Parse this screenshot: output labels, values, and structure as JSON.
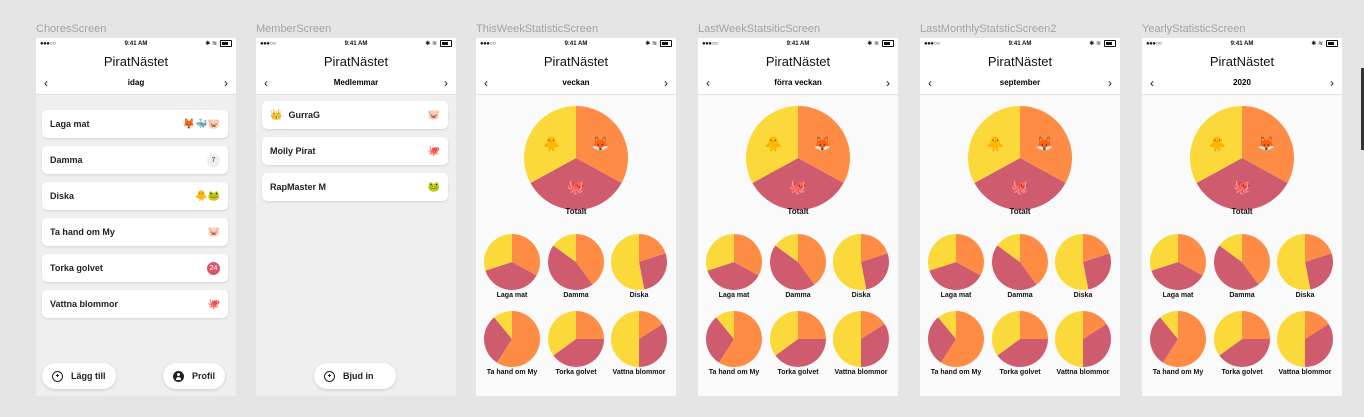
{
  "colors": {
    "orange": "#ff8c45",
    "pink": "#cf5c6e",
    "yellow": "#fcd93b"
  },
  "status": {
    "carrier": "●●●○○",
    "time": "9:41 AM",
    "icons": "✱ ≋"
  },
  "app_title": "PiratNästet",
  "frames": [
    {
      "label": "ChoresScreen",
      "nav_title": "idag"
    },
    {
      "label": "MemberScreen",
      "nav_title": "Medlemmar"
    },
    {
      "label": "ThisWeekStatisticScreen",
      "nav_title": "veckan"
    },
    {
      "label": "LastWeekStatsiticScreen",
      "nav_title": "förra veckan"
    },
    {
      "label": "LastMonthlyStatsticScreen2",
      "nav_title": "september"
    },
    {
      "label": "YearlyStatisticScreen",
      "nav_title": "2020"
    }
  ],
  "chores": [
    {
      "name": "Laga mat",
      "emojis": "🦊🐳🐷"
    },
    {
      "name": "Damma",
      "badge": "7"
    },
    {
      "name": "Diska",
      "emojis": "🐥🐸"
    },
    {
      "name": "Ta hand om My",
      "emojis": "🐷"
    },
    {
      "name": "Torka golvet",
      "badge": "24",
      "badge_red": true
    },
    {
      "name": "Vattna blommor",
      "emojis": "🐙"
    }
  ],
  "chores_buttons": {
    "add": "Lägg till",
    "profile": "Profil"
  },
  "members": [
    {
      "lead": "👑",
      "name": "GurraG",
      "emoji": "🐷"
    },
    {
      "name": "Molly Pirat",
      "emoji": "🐙"
    },
    {
      "name": "RapMaster M",
      "emoji": "🐸"
    }
  ],
  "members_button": "Bjud in",
  "stats": {
    "total_label": "Totalt",
    "total_emojis": {
      "yellow": "🐥",
      "orange": "🦊",
      "pink": "🐙"
    },
    "small_labels": [
      "Laga mat",
      "Damma",
      "Diska",
      "Ta hand om My",
      "Torka golvet",
      "Vattna blommor"
    ]
  },
  "chart_data": {
    "type": "pie",
    "series": [
      {
        "name": "Totalt",
        "values": [
          33,
          34,
          33
        ],
        "colors": [
          "orange",
          "pink",
          "yellow"
        ]
      },
      {
        "name": "Laga mat",
        "values": [
          33,
          37,
          30
        ],
        "colors": [
          "orange",
          "pink",
          "yellow"
        ]
      },
      {
        "name": "Damma",
        "values": [
          40,
          45,
          15
        ],
        "colors": [
          "orange",
          "pink",
          "yellow"
        ]
      },
      {
        "name": "Diska",
        "values": [
          20,
          27,
          53
        ],
        "colors": [
          "orange",
          "pink",
          "yellow"
        ]
      },
      {
        "name": "Ta hand om My",
        "values": [
          59,
          30,
          11
        ],
        "colors": [
          "orange",
          "pink",
          "yellow"
        ]
      },
      {
        "name": "Torka golvet",
        "values": [
          25,
          40,
          35
        ],
        "colors": [
          "orange",
          "pink",
          "yellow"
        ]
      },
      {
        "name": "Vattna blommor",
        "values": [
          16,
          34,
          50
        ],
        "colors": [
          "orange",
          "pink",
          "yellow"
        ]
      }
    ]
  }
}
